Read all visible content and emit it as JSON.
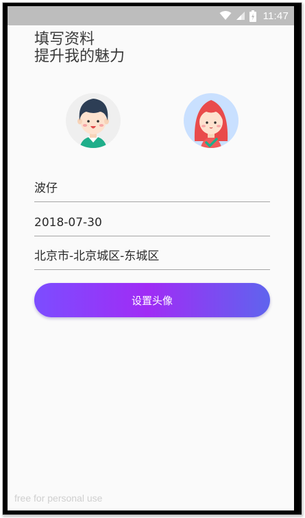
{
  "status_bar": {
    "time": "11:47",
    "icons": [
      "wifi-icon",
      "signal-icon",
      "battery-icon"
    ],
    "background": "#bdbdbd"
  },
  "header": {
    "title_line1": "填写资料",
    "title_line2": "提升我的魅力"
  },
  "avatars": {
    "male": {
      "icon": "male-avatar-icon",
      "background": "#efefef",
      "selected": false
    },
    "female": {
      "icon": "female-avatar-icon",
      "background": "#c9e0ff",
      "selected": true
    }
  },
  "form": {
    "nickname": "波仔",
    "birthday": "2018-07-30",
    "region": "北京市-北京城区-东城区"
  },
  "submit": {
    "label": "设置头像",
    "gradient": [
      "#7c4dff",
      "#a02cf5",
      "#5f64ee"
    ]
  },
  "watermark": "free for personal use"
}
